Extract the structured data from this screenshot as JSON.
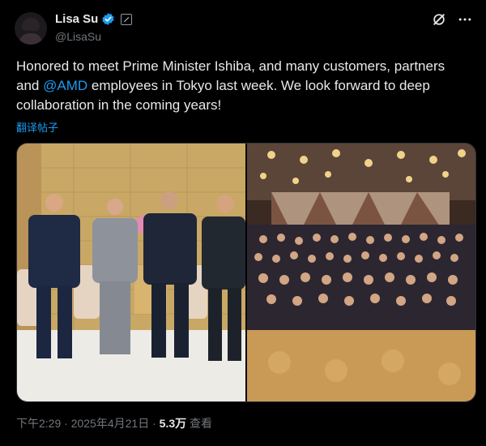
{
  "author": {
    "name": "Lisa Su",
    "handle": "@LisaSu"
  },
  "post": {
    "text_before": "Honored to meet Prime Minister Ishiba, and many customers, partners and ",
    "mention": "@AMD",
    "text_after": " employees in Tokyo last week.  We look forward to deep collaboration in the coming years!",
    "translate_label": "翻译帖子"
  },
  "meta": {
    "time": "下午2:29",
    "sep1": " · ",
    "date": "2025年4月21日",
    "sep2": " · ",
    "views": "5.3万",
    "views_label": " 查看"
  },
  "icons": {
    "verified": "verified-badge-icon",
    "affiliation": "affiliate-badge-icon",
    "grok": "grok-icon",
    "more": "more-options-icon"
  },
  "colors": {
    "accent": "#1d9bf0",
    "text": "#e7e9ea",
    "muted": "#71767b",
    "background": "#000000"
  }
}
